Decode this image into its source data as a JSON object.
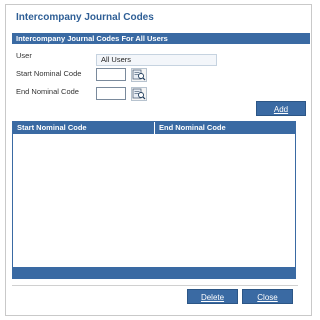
{
  "dialog": {
    "title": "Intercompany Journal Codes",
    "section_title": "Intercompany Journal Codes For All Users"
  },
  "form": {
    "user_label": "User",
    "user_value": "All Users",
    "start_label": "Start Nominal Code",
    "end_label": "End Nominal Code",
    "start_value": "",
    "end_value": ""
  },
  "buttons": {
    "add": "Add",
    "delete": "Delete",
    "close": "Close"
  },
  "grid": {
    "columns": [
      "Start Nominal Code",
      "End Nominal Code"
    ],
    "rows": []
  },
  "icons": {
    "lookup": "search-icon"
  },
  "colors": {
    "accent": "#3a6aa3",
    "title": "#2f5f96"
  }
}
